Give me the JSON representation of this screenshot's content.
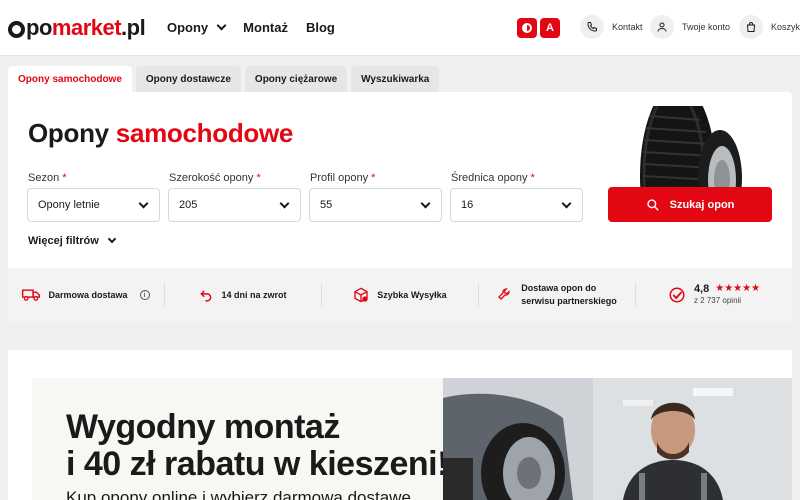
{
  "header": {
    "logo": {
      "part1": "po",
      "part2": "market",
      "part3": ".pl"
    },
    "nav": [
      {
        "label": "Opony",
        "has_dropdown": true
      },
      {
        "label": "Montaż"
      },
      {
        "label": "Blog"
      }
    ],
    "accessibility": {
      "letter_label": "A"
    },
    "utilities": [
      {
        "icon": "phone-icon",
        "label": "Kontakt"
      },
      {
        "icon": "user-icon",
        "label": "Twoje konto"
      },
      {
        "icon": "cart-icon",
        "label": "Koszyk"
      }
    ]
  },
  "tabs": [
    {
      "label": "Opony samochodowe",
      "active": true
    },
    {
      "label": "Opony dostawcze"
    },
    {
      "label": "Opony ciężarowe"
    },
    {
      "label": "Wyszukiwarka"
    }
  ],
  "search": {
    "title_part1": "Opony",
    "title_part2": "samochodowe",
    "fields": [
      {
        "label": "Sezon",
        "required": "*",
        "value": "Opony letnie"
      },
      {
        "label": "Szerokość opony",
        "required": "*",
        "value": "205"
      },
      {
        "label": "Profil opony",
        "required": "*",
        "value": "55"
      },
      {
        "label": "Średnica opony",
        "required": "*",
        "value": "16"
      }
    ],
    "button_label": "Szukaj opon",
    "more_filters": "Więcej filtrów"
  },
  "benefits": [
    {
      "icon": "truck-icon",
      "label": "Darmowa dostawa"
    },
    {
      "icon": "return-icon",
      "label": "14 dni na zwrot"
    },
    {
      "icon": "package-icon",
      "label": "Szybka Wysyłka"
    },
    {
      "icon": "wrench-icon",
      "line1": "Dostawa opon do",
      "line2": "serwisu partnerskiego"
    },
    {
      "icon": "check-circle-icon",
      "rating": "4,8",
      "stars": "★★★★★",
      "reviews": "z 2 737 opinii"
    }
  ],
  "promo": {
    "headline1": "Wygodny montaż",
    "headline2": "i 40 zł rabatu w kieszeni!",
    "subline": "Kup opony online i wybierz darmową dostawę"
  },
  "colors": {
    "brand_red": "#e30613",
    "text": "#1a1a1a"
  }
}
